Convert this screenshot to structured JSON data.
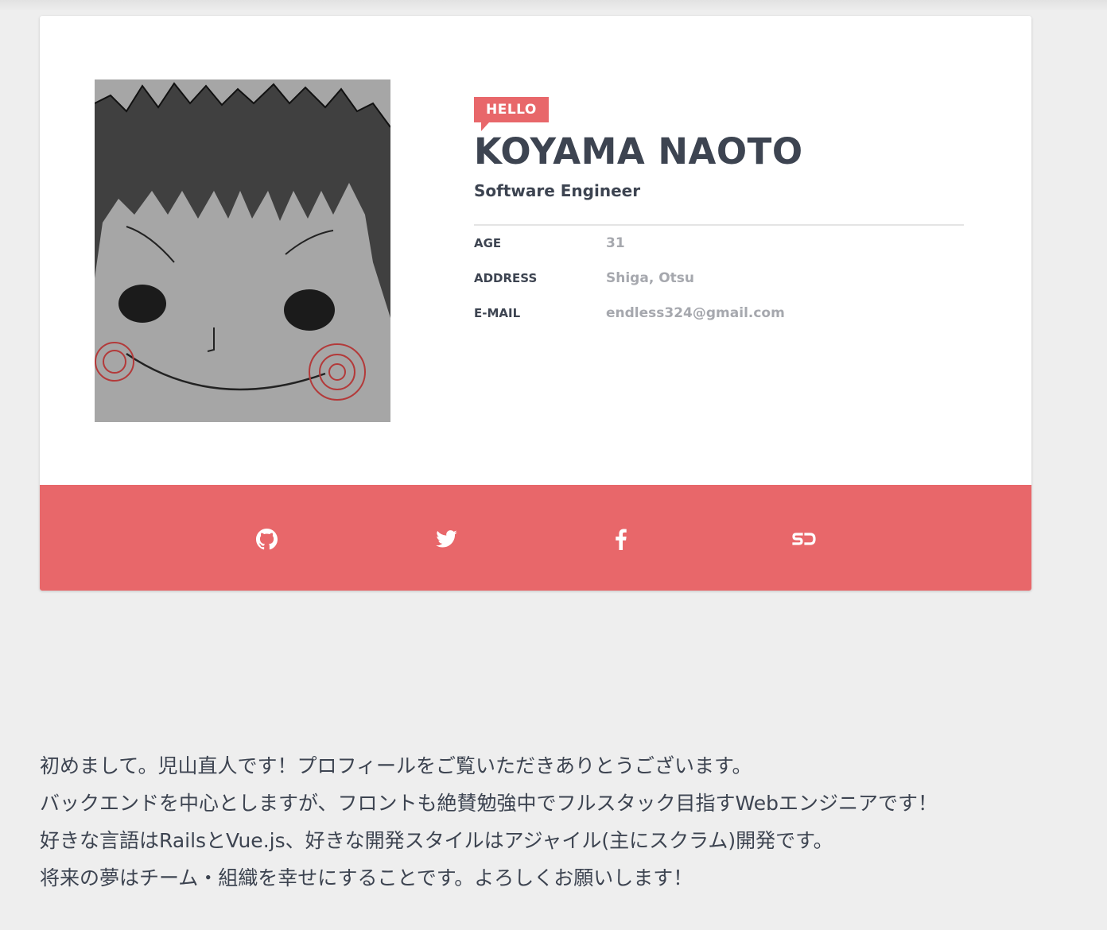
{
  "profile": {
    "badge": "HELLO",
    "name": "KOYAMA NAOTO",
    "title": "Software Engineer",
    "details": [
      {
        "label": "AGE",
        "value": "31"
      },
      {
        "label": "ADDRESS",
        "value": "Shiga, Otsu"
      },
      {
        "label": "E-MAIL",
        "value": "endless324@gmail.com"
      }
    ]
  },
  "social": [
    {
      "icon": "github-icon"
    },
    {
      "icon": "twitter-icon"
    },
    {
      "icon": "facebook-icon"
    },
    {
      "icon": "speakerdeck-icon"
    }
  ],
  "about": {
    "lines": [
      "初めまして。児山直人です！プロフィールをご覧いただきありとうございます。",
      "バックエンドを中心としますが、フロントも絶賛勉強中でフルスタック目指すWebエンジニアです！",
      "好きな言語はRailsとVue.js、好きな開発スタイルはアジャイル(主にスクラム)開発です。",
      "将来の夢はチーム・組織を幸せにすることです。よろしくお願いします！"
    ]
  },
  "colors": {
    "accent": "#e8676a",
    "text": "#3d4451",
    "muted": "#a6a8ae",
    "background": "#eeeeee"
  }
}
